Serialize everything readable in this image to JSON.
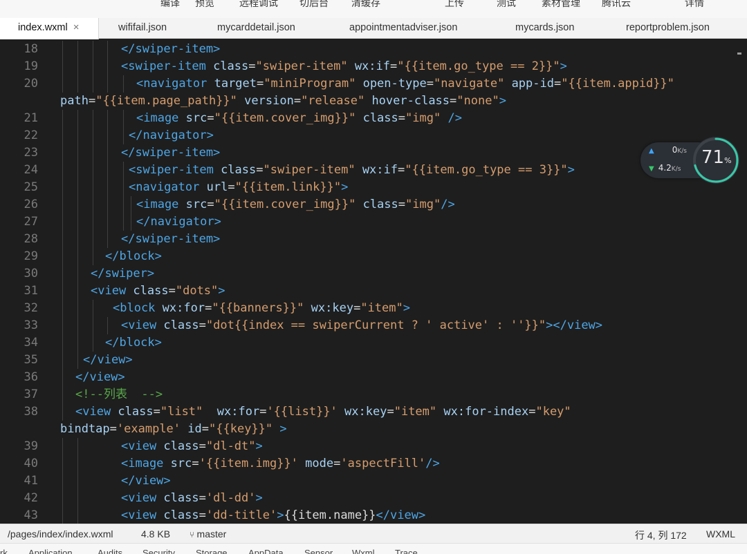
{
  "toolbar": {
    "items": [
      "编译",
      "预览",
      "远程调试",
      "切后台",
      "清缓存",
      "上传",
      "测试",
      "素材管理",
      "腾讯云",
      "详情"
    ]
  },
  "tabs": [
    {
      "label": "index.wxml",
      "active": true,
      "close": "×"
    },
    {
      "label": "wififail.json"
    },
    {
      "label": "mycarddetail.json"
    },
    {
      "label": "appointmentadviser.json"
    },
    {
      "label": "mycards.json"
    },
    {
      "label": "reportproblem.json"
    }
  ],
  "editor": {
    "lines": [
      {
        "n": "18",
        "indent": 175,
        "guides": [
          87,
          109,
          131,
          152
        ],
        "tokens": [
          [
            "tag",
            "</swiper-item>"
          ]
        ]
      },
      {
        "n": "19",
        "indent": 175,
        "guides": [
          87,
          109,
          131,
          152
        ],
        "tokens": [
          [
            "tag",
            "<swiper-item "
          ],
          [
            "attr",
            "class"
          ],
          [
            "txt",
            "="
          ],
          [
            "str",
            "\"swiper-item\""
          ],
          [
            "txt",
            " "
          ],
          [
            "attr",
            "wx:if"
          ],
          [
            "txt",
            "="
          ],
          [
            "str",
            "\"{{item.go_type == 2}}\""
          ],
          [
            "tag",
            ">"
          ]
        ]
      },
      {
        "n": "20",
        "indent": 197,
        "guides": [
          87,
          109,
          131,
          152,
          175
        ],
        "tokens": [
          [
            "tag",
            "<navigator "
          ],
          [
            "attr",
            "target"
          ],
          [
            "txt",
            "="
          ],
          [
            "str",
            "\"miniProgram\""
          ],
          [
            "txt",
            " "
          ],
          [
            "attr",
            "open-type"
          ],
          [
            "txt",
            "="
          ],
          [
            "str",
            "\"navigate\""
          ],
          [
            "txt",
            " "
          ],
          [
            "attr",
            "app-id"
          ],
          [
            "txt",
            "="
          ],
          [
            "str",
            "\"{{item.appid}}\""
          ]
        ]
      },
      {
        "n": "",
        "indent": 87,
        "guides": [],
        "tokens": [
          [
            "attr",
            "path"
          ],
          [
            "txt",
            "="
          ],
          [
            "str",
            "\"{{item.page_path}}\""
          ],
          [
            "txt",
            " "
          ],
          [
            "attr",
            "version"
          ],
          [
            "txt",
            "="
          ],
          [
            "str",
            "\"release\""
          ],
          [
            "txt",
            " "
          ],
          [
            "attr",
            "hover-class"
          ],
          [
            "txt",
            "="
          ],
          [
            "str",
            "\"none\""
          ],
          [
            "tag",
            ">"
          ]
        ]
      },
      {
        "n": "21",
        "indent": 197,
        "guides": [
          87,
          109,
          131,
          152,
          175
        ],
        "tokens": [
          [
            "tag",
            "<image "
          ],
          [
            "attr",
            "src"
          ],
          [
            "txt",
            "="
          ],
          [
            "str",
            "\"{{item.cover_img}}\""
          ],
          [
            "txt",
            " "
          ],
          [
            "attr",
            "class"
          ],
          [
            "txt",
            "="
          ],
          [
            "str",
            "\"img\""
          ],
          [
            "txt",
            " "
          ],
          [
            "tag",
            "/>"
          ]
        ]
      },
      {
        "n": "22",
        "indent": 186,
        "guides": [
          87,
          109,
          131,
          152,
          175
        ],
        "tokens": [
          [
            "tag",
            "</navigator>"
          ]
        ]
      },
      {
        "n": "23",
        "indent": 175,
        "guides": [
          87,
          109,
          131,
          152
        ],
        "tokens": [
          [
            "tag",
            "</swiper-item>"
          ]
        ]
      },
      {
        "n": "24",
        "indent": 186,
        "guides": [
          87,
          109,
          131,
          152,
          175
        ],
        "tokens": [
          [
            "tag",
            "<swiper-item "
          ],
          [
            "attr",
            "class"
          ],
          [
            "txt",
            "="
          ],
          [
            "str",
            "\"swiper-item\""
          ],
          [
            "txt",
            " "
          ],
          [
            "attr",
            "wx:if"
          ],
          [
            "txt",
            "="
          ],
          [
            "str",
            "\"{{item.go_type == 3}}\""
          ],
          [
            "tag",
            ">"
          ]
        ]
      },
      {
        "n": "25",
        "indent": 186,
        "guides": [
          87,
          109,
          131,
          152,
          175
        ],
        "tokens": [
          [
            "tag",
            "<navigator "
          ],
          [
            "attr",
            "url"
          ],
          [
            "txt",
            "="
          ],
          [
            "str",
            "\"{{item.link}}\""
          ],
          [
            "tag",
            ">"
          ]
        ]
      },
      {
        "n": "26",
        "indent": 197,
        "guides": [
          87,
          109,
          131,
          152,
          175,
          186
        ],
        "tokens": [
          [
            "tag",
            "<image "
          ],
          [
            "attr",
            "src"
          ],
          [
            "txt",
            "="
          ],
          [
            "str",
            "\"{{item.cover_img}}\""
          ],
          [
            "txt",
            " "
          ],
          [
            "attr",
            "class"
          ],
          [
            "txt",
            "="
          ],
          [
            "str",
            "\"img\""
          ],
          [
            "tag",
            "/>"
          ]
        ]
      },
      {
        "n": "27",
        "indent": 197,
        "guides": [
          87,
          109,
          131,
          152,
          175,
          186
        ],
        "tokens": [
          [
            "tag",
            "</navigator>"
          ]
        ]
      },
      {
        "n": "28",
        "indent": 175,
        "guides": [
          87,
          109,
          131,
          152
        ],
        "tokens": [
          [
            "tag",
            "</swiper-item>"
          ]
        ]
      },
      {
        "n": "29",
        "indent": 152,
        "guides": [
          87,
          109,
          131
        ],
        "tokens": [
          [
            "tag",
            "</block>"
          ]
        ]
      },
      {
        "n": "30",
        "indent": 131,
        "guides": [
          87,
          109
        ],
        "tokens": [
          [
            "tag",
            "</swiper>"
          ]
        ]
      },
      {
        "n": "31",
        "indent": 131,
        "guides": [
          87,
          109
        ],
        "tokens": [
          [
            "tag",
            "<view "
          ],
          [
            "attr",
            "class"
          ],
          [
            "txt",
            "="
          ],
          [
            "str",
            "\"dots\""
          ],
          [
            "tag",
            ">"
          ]
        ]
      },
      {
        "n": "32",
        "indent": 163,
        "guides": [
          87,
          109,
          131
        ],
        "tokens": [
          [
            "tag",
            "<block "
          ],
          [
            "attr",
            "wx:for"
          ],
          [
            "txt",
            "="
          ],
          [
            "str",
            "\"{{banners}}\""
          ],
          [
            "txt",
            " "
          ],
          [
            "attr",
            "wx:key"
          ],
          [
            "txt",
            "="
          ],
          [
            "str",
            "\"item\""
          ],
          [
            "tag",
            ">"
          ]
        ]
      },
      {
        "n": "33",
        "indent": 175,
        "guides": [
          87,
          109,
          131,
          152
        ],
        "tokens": [
          [
            "tag",
            "<view "
          ],
          [
            "attr",
            "class"
          ],
          [
            "txt",
            "="
          ],
          [
            "str",
            "\"dot{{index == swiperCurrent ? ' active' : ''}}\""
          ],
          [
            "tag",
            "></view>"
          ]
        ]
      },
      {
        "n": "34",
        "indent": 152,
        "guides": [
          87,
          109,
          131
        ],
        "tokens": [
          [
            "tag",
            "</block>"
          ]
        ]
      },
      {
        "n": "35",
        "indent": 120,
        "guides": [
          87,
          109
        ],
        "tokens": [
          [
            "tag",
            "</view>"
          ]
        ]
      },
      {
        "n": "36",
        "indent": 109,
        "guides": [
          87
        ],
        "tokens": [
          [
            "tag",
            "</view>"
          ]
        ]
      },
      {
        "n": "37",
        "indent": 109,
        "guides": [
          87
        ],
        "tokens": [
          [
            "cmt",
            "<!--列表  -->"
          ]
        ]
      },
      {
        "n": "38",
        "indent": 109,
        "guides": [
          87
        ],
        "tokens": [
          [
            "tag",
            "<view "
          ],
          [
            "attr",
            "class"
          ],
          [
            "txt",
            "="
          ],
          [
            "str",
            "\"list\""
          ],
          [
            "txt",
            "  "
          ],
          [
            "attr",
            "wx:for"
          ],
          [
            "txt",
            "="
          ],
          [
            "str",
            "'{{list}}'"
          ],
          [
            "txt",
            " "
          ],
          [
            "attr",
            "wx:key"
          ],
          [
            "txt",
            "="
          ],
          [
            "str",
            "\"item\""
          ],
          [
            "txt",
            " "
          ],
          [
            "attr",
            "wx:for-index"
          ],
          [
            "txt",
            "="
          ],
          [
            "str",
            "\"key\""
          ]
        ]
      },
      {
        "n": "",
        "indent": 87,
        "guides": [],
        "tokens": [
          [
            "attr",
            "bindtap"
          ],
          [
            "txt",
            "="
          ],
          [
            "str",
            "'example'"
          ],
          [
            "txt",
            " "
          ],
          [
            "attr",
            "id"
          ],
          [
            "txt",
            "="
          ],
          [
            "str",
            "\"{{key}}\""
          ],
          [
            "txt",
            " "
          ],
          [
            "tag",
            ">"
          ]
        ]
      },
      {
        "n": "39",
        "indent": 175,
        "guides": [
          87,
          109
        ],
        "tokens": [
          [
            "tag",
            "<view "
          ],
          [
            "attr",
            "class"
          ],
          [
            "txt",
            "="
          ],
          [
            "str",
            "\"dl-dt\""
          ],
          [
            "tag",
            ">"
          ]
        ]
      },
      {
        "n": "40",
        "indent": 175,
        "guides": [
          87,
          109
        ],
        "tokens": [
          [
            "tag",
            "<image "
          ],
          [
            "attr",
            "src"
          ],
          [
            "txt",
            "="
          ],
          [
            "str",
            "'{{item.img}}'"
          ],
          [
            "txt",
            " "
          ],
          [
            "attr",
            "mode"
          ],
          [
            "txt",
            "="
          ],
          [
            "str",
            "'aspectFill'"
          ],
          [
            "tag",
            "/>"
          ]
        ]
      },
      {
        "n": "41",
        "indent": 175,
        "guides": [
          87,
          109
        ],
        "tokens": [
          [
            "tag",
            "</view>"
          ]
        ]
      },
      {
        "n": "42",
        "indent": 175,
        "guides": [
          87,
          109
        ],
        "tokens": [
          [
            "tag",
            "<view "
          ],
          [
            "attr",
            "class"
          ],
          [
            "txt",
            "="
          ],
          [
            "str",
            "'dl-dd'"
          ],
          [
            "tag",
            ">"
          ]
        ]
      },
      {
        "n": "43",
        "indent": 175,
        "guides": [
          87,
          109
        ],
        "tokens": [
          [
            "tag",
            "<view "
          ],
          [
            "attr",
            "class"
          ],
          [
            "txt",
            "="
          ],
          [
            "str",
            "'dd-title'"
          ],
          [
            "tag",
            ">"
          ],
          [
            "txt",
            "{{item.name}}"
          ],
          [
            "tag",
            "</view>"
          ]
        ]
      }
    ]
  },
  "netwidget": {
    "upload": "0",
    "upload_unit": "K/s",
    "download": "4.2",
    "download_unit": "K/s",
    "percent": "71",
    "percent_sign": "%",
    "percent_value": 71
  },
  "statusbar": {
    "path": "/pages/index/index.wxml",
    "size": "4.8 KB",
    "branch": "master",
    "position": "行 4, 列 172",
    "language": "WXML"
  },
  "bottom_tabs": [
    "rk",
    "Application",
    "Audits",
    "Security",
    "Storage",
    "AppData",
    "Sensor",
    "Wxml",
    "Trace"
  ],
  "colors": {
    "editor_bg": "#1e1e1e",
    "tag": "#4ea6e6",
    "attr": "#a7d2f4",
    "string": "#d69d6e",
    "comment": "#59a84a",
    "line_number": "#7a7a7a"
  }
}
